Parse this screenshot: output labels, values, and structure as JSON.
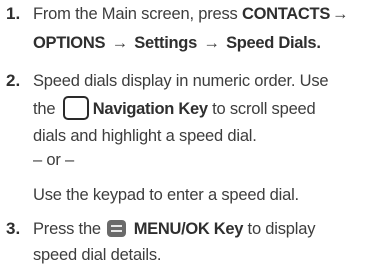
{
  "steps": [
    {
      "number": "1.",
      "line1_a": "From the Main screen, press ",
      "contacts": "CONTACTS",
      "arrow": "→",
      "options": "OPTIONS",
      "settings": "Settings",
      "speed_dials": "Speed Dials",
      "period": "."
    },
    {
      "number": "2.",
      "line1": "Speed dials display in numeric order. Use",
      "line2_a": "the",
      "line2_key": "Navigation Key",
      "line2_b": " to scroll speed",
      "line3": "dials and highlight a speed dial.",
      "or": "– or –",
      "line5": "Use the keypad to enter a speed dial."
    },
    {
      "number": "3.",
      "line1_a": "Press the",
      "line1_key": "MENU/OK Key",
      "line1_b": " to display",
      "line2": "speed dial details."
    }
  ],
  "icons": [
    "navigation-key-icon",
    "menu-ok-key-icon"
  ]
}
